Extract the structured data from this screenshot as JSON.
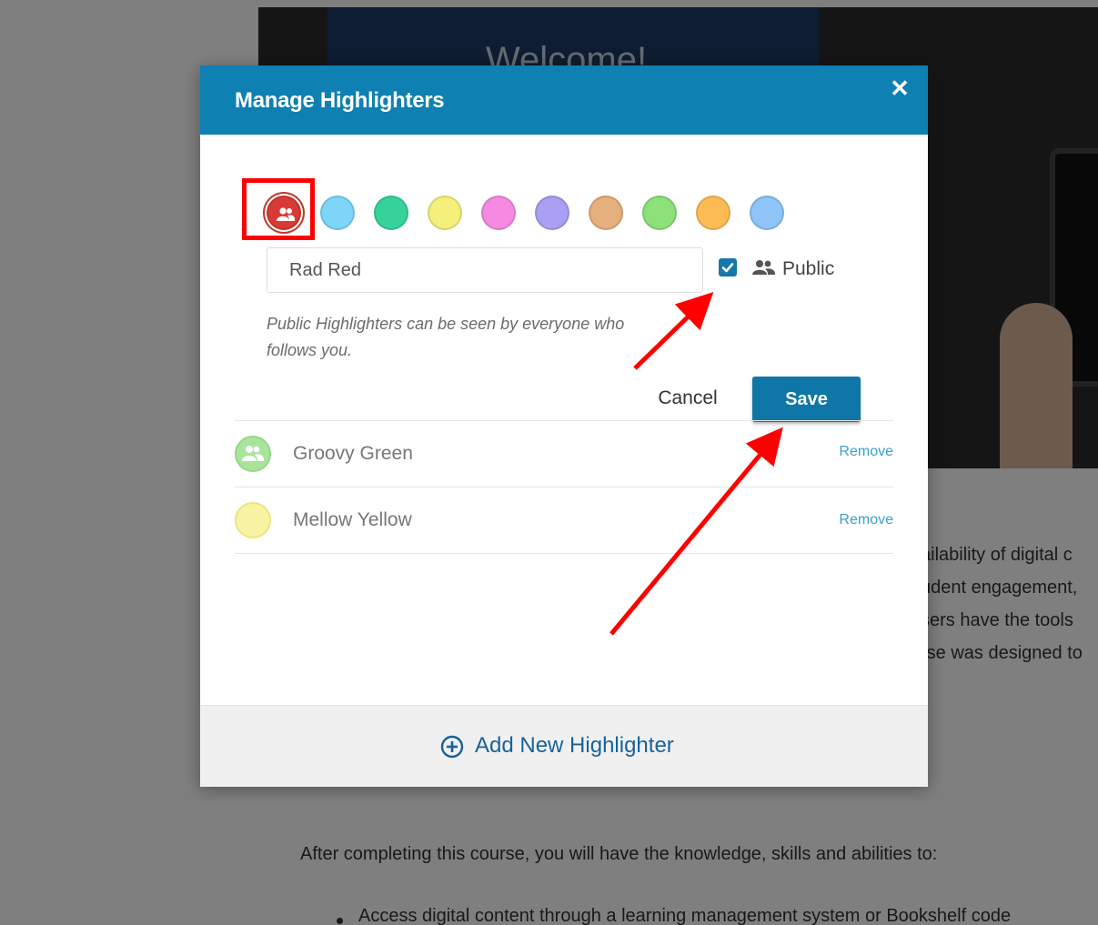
{
  "background": {
    "hero_title": "Welcome!",
    "body_lines": [
      "ailability of digital c",
      "udent engagement,",
      "sers have the tools",
      "rse was designed to"
    ],
    "objectives_intro": "After completing this course, you will have the knowledge, skills and abilities to:",
    "bullet_1": "Access digital content through a learning management system or Bookshelf code"
  },
  "modal": {
    "title": "Manage Highlighters",
    "close_icon": "close-icon",
    "swatches": [
      {
        "color": "#d93a35",
        "selected": true,
        "icon": "group-icon"
      },
      {
        "color": "#7dd6f7"
      },
      {
        "color": "#35d39a"
      },
      {
        "color": "#f4f07b"
      },
      {
        "color": "#f58be0"
      },
      {
        "color": "#a99ff3"
      },
      {
        "color": "#e6b07e"
      },
      {
        "color": "#8ee07a"
      },
      {
        "color": "#fdbb54"
      },
      {
        "color": "#8ec4f7"
      }
    ],
    "name_input_value": "Rad Red",
    "public_checked": true,
    "public_label": "Public",
    "help_text": "Public Highlighters can be seen by everyone who follows you.",
    "cancel_label": "Cancel",
    "save_label": "Save",
    "highlighters": [
      {
        "name": "Groovy Green",
        "color": "#a8e59b",
        "public": true,
        "remove_label": "Remove"
      },
      {
        "name": "Mellow Yellow",
        "color": "#f8f4a4",
        "public": false,
        "remove_label": "Remove"
      }
    ],
    "add_label": "Add New Highlighter"
  },
  "colors": {
    "header": "#0e80b1",
    "save": "#0e77a8",
    "annotation": "#ff0000",
    "link": "#3aa0cf"
  }
}
